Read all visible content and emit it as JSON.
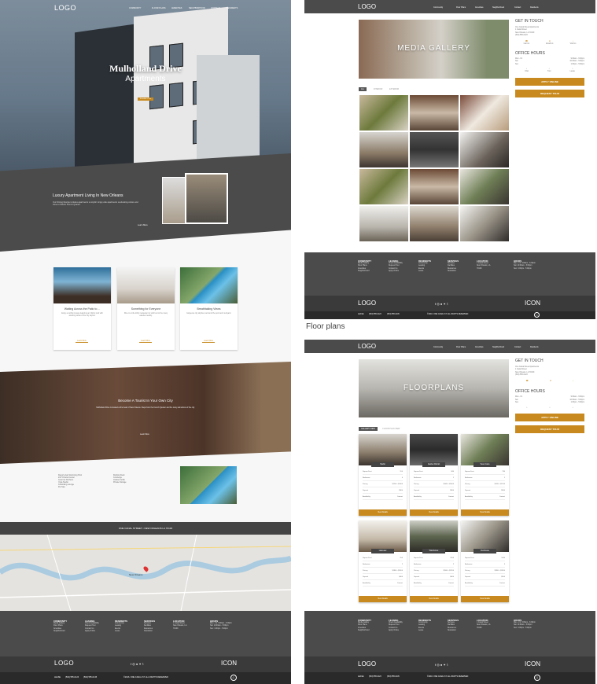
{
  "left": {
    "logo": "LOGO",
    "nav": [
      "Community",
      "Floor Plans",
      "Amenities",
      "Neighborhood",
      "Contact",
      "Residents"
    ],
    "hero_title": "Mulholland Drive",
    "hero_subtitle": "Apartments",
    "hero_button": "Schedule a Tour",
    "intro_title": "Luxury Apartment Living In New Orleans",
    "intro_text": "Our thriving lifestyle includes apartments so stylish. Enjoy elite apartments overlooking culture and close to historic French Quarter.",
    "intro_link": "Learn More",
    "cards": [
      {
        "title": "Waiting Across the Patio to ...",
        "text": "Enjoy a rooftop lounge featuring an infinity pool with amazing views of the city skyline.",
        "link": "Learn More"
      },
      {
        "title": "Something for Everyone",
        "text": "Dine in at the lobby restaurant or stroll out to the many eateries nearby.",
        "link": "Learn More"
      },
      {
        "title": "Breathtaking Views",
        "text": "Gorgeous city skylines surround the pool and courtyard.",
        "link": "Learn More"
      }
    ],
    "brick_title": "Become A Tourist In Your Own City",
    "brick_text": "Mulholland Drive is located at the heart of New Orleans. Steps from the French Quarter and the many attractions of the city.",
    "brick_link": "Learn More",
    "amenities_col1": [
      "Resort-style Swimming Pool",
      "24/7 Fitness Center",
      "Gourmet Kitchens",
      "Yoga Studio",
      "Coworking Lounge",
      "Pet Spa"
    ],
    "amenities_col2": [
      "Rooftop Deck",
      "Concierge",
      "Outdoor Grills",
      "Private Storage"
    ],
    "address_bar": "ONE CANAL STREET • NEW ORLEANS LA 70130",
    "map_label": "New Orleans",
    "footer_cols": [
      {
        "head": "COMMUNITY",
        "items": [
          "Media Gallery",
          "Floor Plans",
          "Amenities",
          "Neighborhood"
        ]
      },
      {
        "head": "LEASING",
        "items": [
          "Check Availability",
          "Request Tour",
          "Contact Us",
          "Apply Online"
        ]
      },
      {
        "head": "RESIDENTS",
        "items": [
          "Community",
          "Leasing",
          "Events",
          "Lease"
        ]
      },
      {
        "head": "SERVICES",
        "items": [
          "Services",
          "Facilities",
          "Resources",
          "Newsletter"
        ]
      },
      {
        "head": "LOCATION",
        "items": [
          "1 Canal Street",
          "New Orleans, LA",
          "70130"
        ]
      },
      {
        "head": "HOURS",
        "items": [
          "Mon - Fri: 9:00am - 6:00pm",
          "Sat: 10:00am - 5:00pm",
          "Sun: 1:00pm - 5:00pm"
        ]
      }
    ],
    "sub_logo": "LOGO",
    "sub_icon": "ICON",
    "bottom_text": [
      "LEASE",
      "(504) 555-0123",
      "(504) 555-0145"
    ],
    "copyright": "©2016. ONE CANAL ST. ALL RIGHTS RESERVED"
  },
  "gallery": {
    "logo": "LOGO",
    "nav": [
      "Community",
      "Floor Plans",
      "Amenities",
      "Neighborhood",
      "Contact",
      "Residents"
    ],
    "banner_title": "MEDIA GALLERY",
    "tabs": [
      "ALL",
      "INTERIOR",
      "EXTERIOR"
    ],
    "contact_heading": "GET IN TOUCH",
    "contact_lines": [
      "One Canal Street Apartments",
      "1 Canal Street",
      "New Orleans, LA 70130",
      "(504) 555-0123"
    ],
    "contact_icons": [
      "Call Us",
      "Email Us",
      "Visit Us"
    ],
    "hours_heading": "OFFICE HOURS",
    "hours": [
      [
        "Mon - Fri",
        "9:00am - 6:00pm"
      ],
      [
        "Sat",
        "10:00am - 5:00pm"
      ],
      [
        "Sun",
        "1:00pm - 5:00pm"
      ]
    ],
    "hours_icons": [
      "Chat",
      "Tour",
      "Lease"
    ],
    "apply_button": "APPLY ONLINE",
    "tour_button": "REQUEST TOUR",
    "sub_logo": "LOGO",
    "sub_icon": "ICON",
    "bottom_text": [
      "LEASE",
      "(504) 555-0123",
      "(504) 555-0145"
    ],
    "copyright": "©2016. ONE CANAL ST. ALL RIGHTS RESERVED"
  },
  "caption": "Floor plans",
  "floorplans": {
    "logo": "LOGO",
    "nav": [
      "Community",
      "Floor Plans",
      "Amenities",
      "Neighborhood",
      "Contact",
      "Residents"
    ],
    "banner_title": "FLOORPLANS",
    "tabs": [
      "GALLERY VIEW",
      "FLOOR PLAN VIEW"
    ],
    "contact_heading": "GET IN TOUCH",
    "contact_lines": [
      "One Canal Street Apartments",
      "1 Canal Street",
      "New Orleans, LA 70130",
      "(504) 555-0123"
    ],
    "hours_heading": "OFFICE HOURS",
    "hours": [
      [
        "Mon - Fri",
        "9:00am - 6:00pm"
      ],
      [
        "Sat",
        "10:00am - 5:00pm"
      ],
      [
        "Sun",
        "1:00pm - 5:00pm"
      ]
    ],
    "apply_button": "APPLY ONLINE",
    "tour_button": "REQUEST TOUR",
    "plans": [
      {
        "name": "Studio",
        "rows": [
          [
            "Square Feet",
            "550"
          ],
          [
            "Bedrooms",
            "0"
          ],
          [
            "Pricing",
            "$1200 - $1400"
          ],
          [
            "Deposit",
            "$300"
          ],
          [
            "Availability",
            "Contact"
          ]
        ],
        "button": "View Details"
      },
      {
        "name": "Garden District",
        "rows": [
          [
            "Square Feet",
            "680"
          ],
          [
            "Bedrooms",
            "1"
          ],
          [
            "Pricing",
            "$1400 - $1600"
          ],
          [
            "Deposit",
            "$300"
          ],
          [
            "Availability",
            "Contact"
          ]
        ],
        "button": "View Details"
      },
      {
        "name": "Vieux Carre",
        "rows": [
          [
            "Square Feet",
            "780"
          ],
          [
            "Bedrooms",
            "1"
          ],
          [
            "Pricing",
            "$1500 - $1700"
          ],
          [
            "Deposit",
            "$300"
          ],
          [
            "Availability",
            "Contact"
          ]
        ],
        "button": "View Details"
      },
      {
        "name": "Lakeview",
        "rows": [
          [
            "Square Feet",
            "950"
          ],
          [
            "Bedrooms",
            "2"
          ],
          [
            "Pricing",
            "$1800 - $2000"
          ],
          [
            "Deposit",
            "$400"
          ],
          [
            "Availability",
            "Contact"
          ]
        ],
        "button": "View Details"
      },
      {
        "name": "Warehouse",
        "rows": [
          [
            "Square Feet",
            "1050"
          ],
          [
            "Bedrooms",
            "2"
          ],
          [
            "Pricing",
            "$2000 - $2200"
          ],
          [
            "Deposit",
            "$400"
          ],
          [
            "Availability",
            "Contact"
          ]
        ],
        "button": "View Details"
      },
      {
        "name": "Penthouse",
        "rows": [
          [
            "Square Feet",
            "1400"
          ],
          [
            "Bedrooms",
            "3"
          ],
          [
            "Pricing",
            "$2800 - $3200"
          ],
          [
            "Deposit",
            "$500"
          ],
          [
            "Availability",
            "Contact"
          ]
        ],
        "button": "View Details"
      }
    ],
    "sub_logo": "LOGO",
    "sub_icon": "ICON",
    "bottom_text": [
      "LEASE",
      "(504) 555-0123",
      "(504) 555-0145"
    ],
    "copyright": "©2016. ONE CANAL ST. ALL RIGHTS RESERVED"
  },
  "colors": {
    "accent": "#c88a1e",
    "dark": "#4b4b4b",
    "darker": "#3a3a3a"
  }
}
